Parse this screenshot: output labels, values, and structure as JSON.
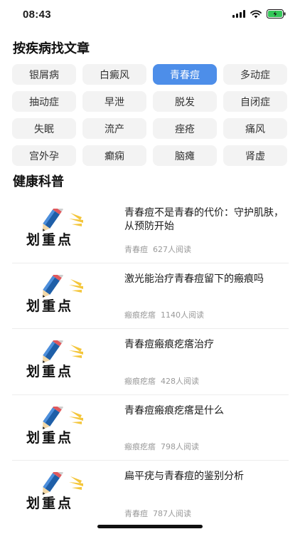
{
  "status": {
    "time": "08:43"
  },
  "sections": {
    "find_by_disease": "按疾病找文章",
    "health_science": "健康科普"
  },
  "diseases": [
    {
      "label": "银屑病",
      "active": false
    },
    {
      "label": "白癜风",
      "active": false
    },
    {
      "label": "青春痘",
      "active": true
    },
    {
      "label": "多动症",
      "active": false
    },
    {
      "label": "抽动症",
      "active": false
    },
    {
      "label": "早泄",
      "active": false
    },
    {
      "label": "脱发",
      "active": false
    },
    {
      "label": "自闭症",
      "active": false
    },
    {
      "label": "失眠",
      "active": false
    },
    {
      "label": "流产",
      "active": false
    },
    {
      "label": "痤疮",
      "active": false
    },
    {
      "label": "痛风",
      "active": false
    },
    {
      "label": "宫外孕",
      "active": false
    },
    {
      "label": "癫痫",
      "active": false
    },
    {
      "label": "脑瘫",
      "active": false
    },
    {
      "label": "肾虚",
      "active": false
    }
  ],
  "thumbnail": {
    "caption": "划重点"
  },
  "articles": [
    {
      "title": "青春痘不是青春的代价：守护肌肤，从预防开始",
      "tag": "青春痘",
      "reads": "627人阅读"
    },
    {
      "title": "激光能治疗青春痘留下的瘢痕吗",
      "tag": "瘢痕疙瘩",
      "reads": "1140人阅读"
    },
    {
      "title": "青春痘瘢痕疙瘩治疗",
      "tag": "瘢痕疙瘩",
      "reads": "428人阅读"
    },
    {
      "title": "青春痘瘢痕疙瘩是什么",
      "tag": "瘢痕疙瘩",
      "reads": "798人阅读"
    },
    {
      "title": "扁平疣与青春痘的鉴别分析",
      "tag": "青春痘",
      "reads": "787人阅读"
    }
  ],
  "colors": {
    "accent": "#4d8ee9",
    "chip_bg": "#f3f3f3",
    "meta_text": "#9a9a9a"
  }
}
